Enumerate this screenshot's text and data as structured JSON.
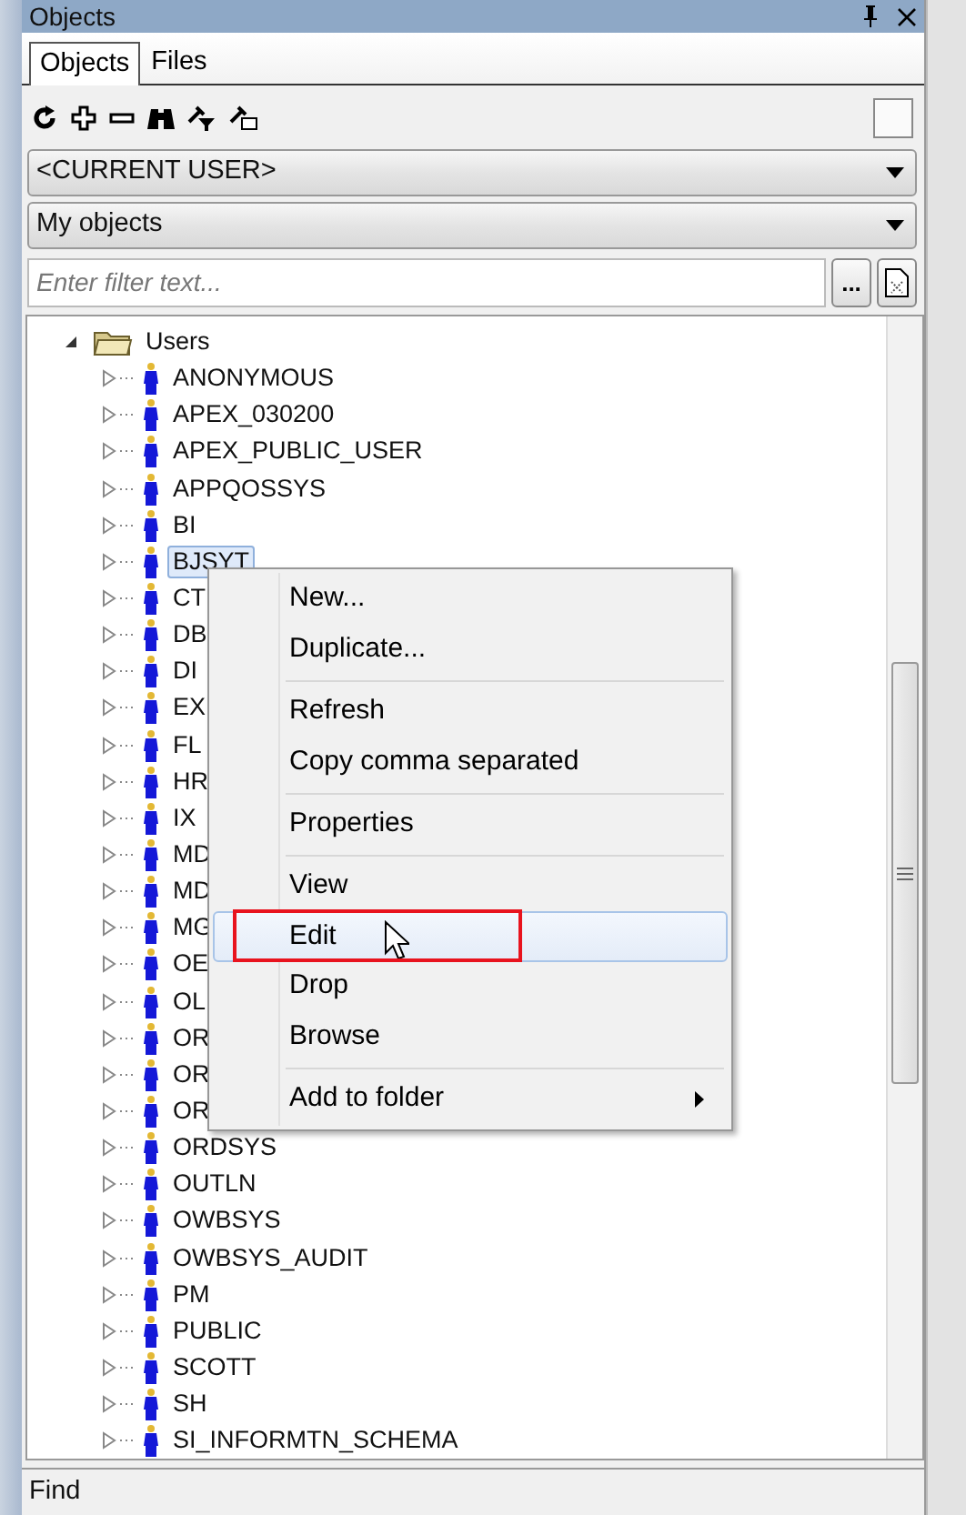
{
  "panel": {
    "title": "Objects"
  },
  "tabs": [
    {
      "label": "Objects",
      "selected": true
    },
    {
      "label": "Files",
      "selected": false
    }
  ],
  "user_combo": {
    "value": "<CURRENT USER>"
  },
  "scope_combo": {
    "value": "My objects"
  },
  "filter": {
    "placeholder": "Enter filter text...",
    "button": "..."
  },
  "tree": [
    {
      "label": "Users",
      "kind": "folder",
      "expanded": true,
      "selected": false,
      "children": [
        {
          "label": "ANONYMOUS",
          "kind": "user",
          "expanded": false,
          "selected": false
        },
        {
          "label": "APEX_030200",
          "kind": "user",
          "expanded": false,
          "selected": false
        },
        {
          "label": "APEX_PUBLIC_USER",
          "kind": "user",
          "expanded": false,
          "selected": false
        },
        {
          "label": "APPQOSSYS",
          "kind": "user",
          "expanded": false,
          "selected": false
        },
        {
          "label": "BI",
          "kind": "user",
          "expanded": false,
          "selected": false
        },
        {
          "label": "BJSYT",
          "kind": "user",
          "expanded": false,
          "selected": true
        },
        {
          "label": "CT",
          "kind": "user",
          "expanded": false,
          "selected": false
        },
        {
          "label": "DB",
          "kind": "user",
          "expanded": false,
          "selected": false
        },
        {
          "label": "DI",
          "kind": "user",
          "expanded": false,
          "selected": false
        },
        {
          "label": "EX",
          "kind": "user",
          "expanded": false,
          "selected": false
        },
        {
          "label": "FL",
          "kind": "user",
          "expanded": false,
          "selected": false
        },
        {
          "label": "HR",
          "kind": "user",
          "expanded": false,
          "selected": false
        },
        {
          "label": "IX",
          "kind": "user",
          "expanded": false,
          "selected": false
        },
        {
          "label": "MD",
          "kind": "user",
          "expanded": false,
          "selected": false
        },
        {
          "label": "MD",
          "kind": "user",
          "expanded": false,
          "selected": false
        },
        {
          "label": "MG",
          "kind": "user",
          "expanded": false,
          "selected": false
        },
        {
          "label": "OE",
          "kind": "user",
          "expanded": false,
          "selected": false
        },
        {
          "label": "OL",
          "kind": "user",
          "expanded": false,
          "selected": false
        },
        {
          "label": "OR",
          "kind": "user",
          "expanded": false,
          "selected": false
        },
        {
          "label": "OR",
          "kind": "user",
          "expanded": false,
          "selected": false
        },
        {
          "label": "OR",
          "kind": "user",
          "expanded": false,
          "selected": false
        },
        {
          "label": "ORDSYS",
          "kind": "user",
          "expanded": false,
          "selected": false
        },
        {
          "label": "OUTLN",
          "kind": "user",
          "expanded": false,
          "selected": false
        },
        {
          "label": "OWBSYS",
          "kind": "user",
          "expanded": false,
          "selected": false
        },
        {
          "label": "OWBSYS_AUDIT",
          "kind": "user",
          "expanded": false,
          "selected": false
        },
        {
          "label": "PM",
          "kind": "user",
          "expanded": false,
          "selected": false
        },
        {
          "label": "PUBLIC",
          "kind": "user",
          "expanded": false,
          "selected": false
        },
        {
          "label": "SCOTT",
          "kind": "user",
          "expanded": false,
          "selected": false
        },
        {
          "label": "SH",
          "kind": "user",
          "expanded": false,
          "selected": false
        },
        {
          "label": "SI_INFORMTN_SCHEMA",
          "kind": "user",
          "expanded": false,
          "selected": false
        }
      ]
    }
  ],
  "context_menu": {
    "groups": [
      [
        {
          "label": "New...",
          "selected": false,
          "submenu": false,
          "annotated": false
        },
        {
          "label": "Duplicate...",
          "selected": false,
          "submenu": false,
          "annotated": false
        }
      ],
      [
        {
          "label": "Refresh",
          "selected": false,
          "submenu": false,
          "annotated": false
        },
        {
          "label": "Copy comma separated",
          "selected": false,
          "submenu": false,
          "annotated": false
        }
      ],
      [
        {
          "label": "Properties",
          "selected": false,
          "submenu": false,
          "annotated": false
        }
      ],
      [
        {
          "label": "View",
          "selected": false,
          "submenu": false,
          "annotated": false
        },
        {
          "label": "Edit",
          "selected": true,
          "submenu": false,
          "annotated": true
        },
        {
          "label": "Drop",
          "selected": false,
          "submenu": false,
          "annotated": false
        },
        {
          "label": "Browse",
          "selected": false,
          "submenu": false,
          "annotated": false
        }
      ],
      [
        {
          "label": "Add to folder",
          "selected": false,
          "submenu": true,
          "annotated": false
        }
      ]
    ]
  },
  "status_bar": {
    "text": "Find"
  }
}
